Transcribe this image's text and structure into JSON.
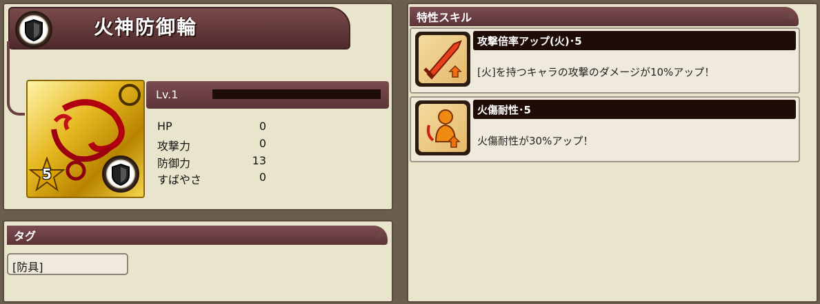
{
  "item": {
    "name": "火神防御輪",
    "level_label": "Lv.1",
    "rarity": "5"
  },
  "stats": [
    {
      "label": "HP",
      "value": "0"
    },
    {
      "label": "攻撃力",
      "value": "0"
    },
    {
      "label": "防御力",
      "value": "13"
    },
    {
      "label": "すばやさ",
      "value": "0"
    }
  ],
  "tags": {
    "header": "タグ",
    "items": [
      "[防具]"
    ]
  },
  "skills": {
    "header": "特性スキル",
    "list": [
      {
        "title": "攻撃倍率アップ(火)･5",
        "desc": "[火]を持つキャラの攻撃のダメージが10%アップ！",
        "icon": "sword-fire-icon"
      },
      {
        "title": "火傷耐性･5",
        "desc": "火傷耐性が30%アップ！",
        "icon": "burn-resist-icon"
      }
    ]
  },
  "colors": {
    "header": "#6b3f43",
    "panel": "#e9e4cc",
    "bar": "#1e0c06"
  }
}
